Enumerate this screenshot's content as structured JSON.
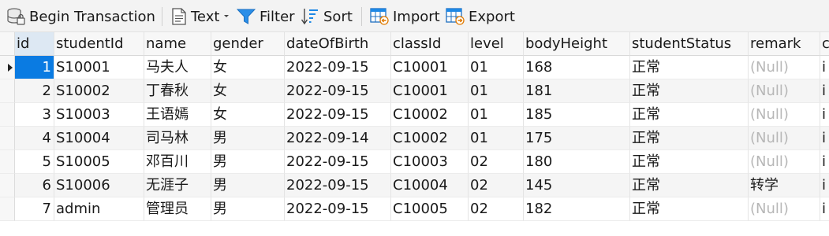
{
  "toolbar": {
    "begin_transaction": "Begin Transaction",
    "text": "Text",
    "filter": "Filter",
    "sort": "Sort",
    "import": "Import",
    "export": "Export"
  },
  "columns": [
    "id",
    "studentId",
    "name",
    "gender",
    "dateOfBirth",
    "classId",
    "level",
    "bodyHeight",
    "studentStatus",
    "remark",
    "c"
  ],
  "rows": [
    {
      "id": "1",
      "studentId": "S10001",
      "name": "马夫人",
      "gender": "女",
      "dateOfBirth": "2022-09-15",
      "classId": "C10001",
      "level": "01",
      "bodyHeight": "168",
      "studentStatus": "正常",
      "remark": "(Null)",
      "extra": "i"
    },
    {
      "id": "2",
      "studentId": "S10002",
      "name": "丁春秋",
      "gender": "女",
      "dateOfBirth": "2022-09-15",
      "classId": "C10001",
      "level": "01",
      "bodyHeight": "181",
      "studentStatus": "正常",
      "remark": "(Null)",
      "extra": "i"
    },
    {
      "id": "3",
      "studentId": "S10003",
      "name": "王语嫣",
      "gender": "女",
      "dateOfBirth": "2022-09-15",
      "classId": "C10002",
      "level": "01",
      "bodyHeight": "185",
      "studentStatus": "正常",
      "remark": "(Null)",
      "extra": "i"
    },
    {
      "id": "4",
      "studentId": "S10004",
      "name": "司马林",
      "gender": "男",
      "dateOfBirth": "2022-09-14",
      "classId": "C10002",
      "level": "01",
      "bodyHeight": "175",
      "studentStatus": "正常",
      "remark": "(Null)",
      "extra": "i"
    },
    {
      "id": "5",
      "studentId": "S10005",
      "name": "邓百川",
      "gender": "男",
      "dateOfBirth": "2022-09-15",
      "classId": "C10003",
      "level": "02",
      "bodyHeight": "180",
      "studentStatus": "正常",
      "remark": "(Null)",
      "extra": "i"
    },
    {
      "id": "6",
      "studentId": "S10006",
      "name": "无涯子",
      "gender": "男",
      "dateOfBirth": "2022-09-15",
      "classId": "C10004",
      "level": "02",
      "bodyHeight": "145",
      "studentStatus": "正常",
      "remark": "转学",
      "extra": "i"
    },
    {
      "id": "7",
      "studentId": "admin",
      "name": "管理员",
      "gender": "男",
      "dateOfBirth": "2022-09-15",
      "classId": "C10005",
      "level": "02",
      "bodyHeight": "182",
      "studentStatus": "正常",
      "remark": "(Null)",
      "extra": "i"
    }
  ],
  "selected_row_index": 0,
  "colors": {
    "selection": "#0a7be2",
    "null_text": "#b7b7b7",
    "icon_blue": "#1e88e5"
  },
  "icons": [
    "database-icon",
    "text-icon",
    "filter-icon",
    "sort-icon",
    "import-icon",
    "export-icon",
    "current-row-arrow-icon"
  ]
}
